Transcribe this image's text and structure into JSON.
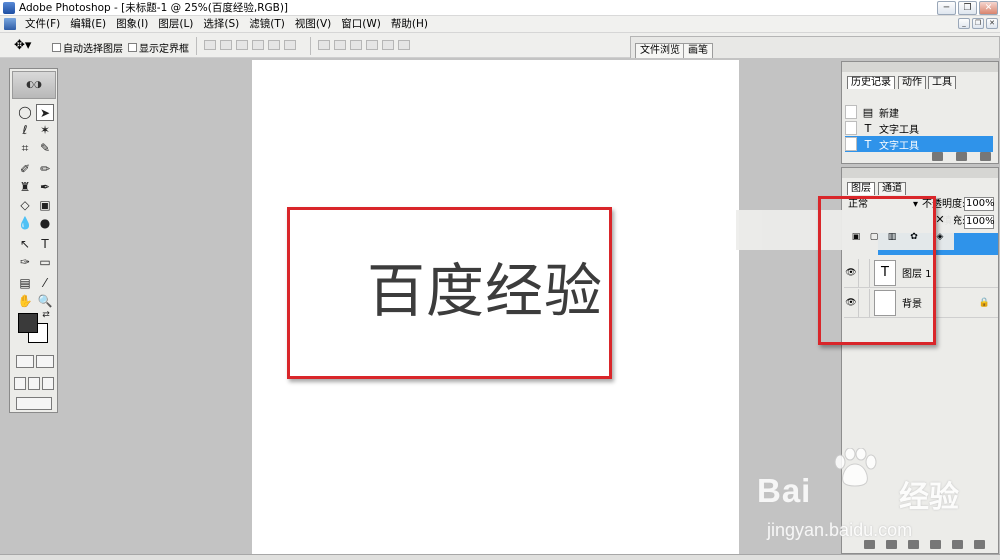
{
  "window": {
    "title": "Adobe Photoshop - [未标题-1 @ 25%(百度经验,RGB)]"
  },
  "menu": {
    "items": [
      "文件(F)",
      "编辑(E)",
      "图象(I)",
      "图层(L)",
      "选择(S)",
      "滤镜(T)",
      "视图(V)",
      "窗口(W)",
      "帮助(H)"
    ]
  },
  "options": {
    "auto_select_label": "自动选择图层",
    "show_bounds_label": "显示定界框"
  },
  "palette_well": {
    "tabs": [
      "文件浏览",
      "画笔"
    ]
  },
  "canvas": {
    "text": "百度经验"
  },
  "history_panel": {
    "tabs": [
      "历史记录",
      "动作",
      "工具"
    ],
    "items": [
      {
        "label": "新建",
        "icon": "document-icon",
        "selected": false
      },
      {
        "label": "文字工具",
        "icon": "type-tool-icon",
        "selected": false
      },
      {
        "label": "文字工具",
        "icon": "type-tool-icon",
        "selected": true
      }
    ]
  },
  "layers_panel": {
    "tabs": [
      "图层",
      "通道"
    ],
    "blend_mode": "正常",
    "opacity_label": "不透明度:",
    "opacity_value": "100%",
    "fill_label": "填充:",
    "fill_value": "100%",
    "layers": [
      {
        "name": "图层 1",
        "type": "text",
        "visible": true
      },
      {
        "name": "背景",
        "type": "background",
        "visible": true,
        "locked": true
      }
    ]
  },
  "watermark": {
    "brand": "Bai",
    "brand_tail": "经验",
    "url": "jingyan.baidu.com"
  },
  "colors": {
    "highlight": "#2f93ea",
    "annotation_red": "#d9262a",
    "foreground": "#3a3a3a",
    "background": "#ffffff"
  }
}
